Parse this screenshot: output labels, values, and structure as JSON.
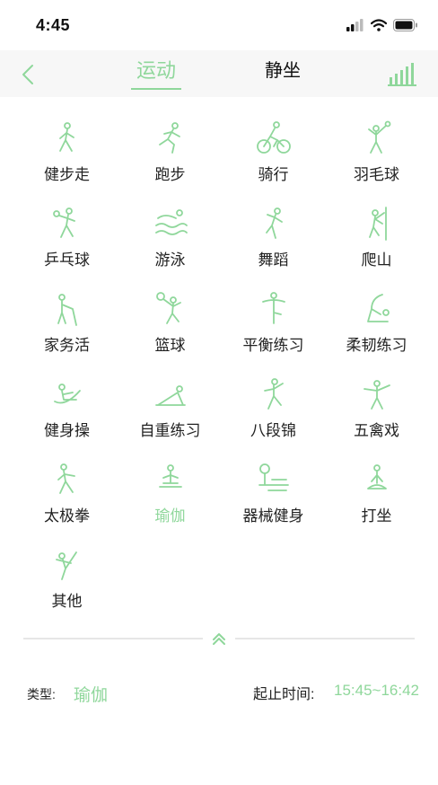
{
  "status_bar": {
    "time": "4:45"
  },
  "nav": {
    "tabs": [
      {
        "label": "运动",
        "active": true
      },
      {
        "label": "静坐",
        "active": false
      }
    ]
  },
  "colors": {
    "accent": "#8fd79b",
    "text": "#222222",
    "nav_bg": "#f7f7f7"
  },
  "activities": [
    {
      "label": "健步走",
      "icon": "walking-icon"
    },
    {
      "label": "跑步",
      "icon": "running-icon"
    },
    {
      "label": "骑行",
      "icon": "cycling-icon"
    },
    {
      "label": "羽毛球",
      "icon": "badminton-icon"
    },
    {
      "label": "乒乓球",
      "icon": "table-tennis-icon"
    },
    {
      "label": "游泳",
      "icon": "swimming-icon"
    },
    {
      "label": "舞蹈",
      "icon": "dance-icon"
    },
    {
      "label": "爬山",
      "icon": "climbing-icon"
    },
    {
      "label": "家务活",
      "icon": "housework-icon"
    },
    {
      "label": "篮球",
      "icon": "basketball-icon"
    },
    {
      "label": "平衡练习",
      "icon": "balance-icon"
    },
    {
      "label": "柔韧练习",
      "icon": "flexibility-icon"
    },
    {
      "label": "健身操",
      "icon": "aerobics-icon"
    },
    {
      "label": "自重练习",
      "icon": "bodyweight-icon"
    },
    {
      "label": "八段锦",
      "icon": "baduanjin-icon"
    },
    {
      "label": "五禽戏",
      "icon": "wuqinxi-icon"
    },
    {
      "label": "太极拳",
      "icon": "taichi-icon"
    },
    {
      "label": "瑜伽",
      "icon": "yoga-icon",
      "selected": true
    },
    {
      "label": "器械健身",
      "icon": "equipment-icon"
    },
    {
      "label": "打坐",
      "icon": "meditation-icon"
    },
    {
      "label": "其他",
      "icon": "other-icon"
    }
  ],
  "footer": {
    "type_label": "类型:",
    "type_value": "瑜伽",
    "time_label": "起止时间:",
    "time_value": "15:45~16:42"
  }
}
